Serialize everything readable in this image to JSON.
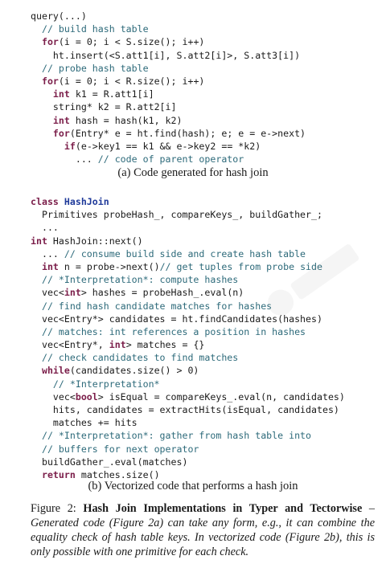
{
  "code_a": [
    {
      "indent": 0,
      "tokens": [
        {
          "t": "query(...)",
          "c": ""
        }
      ]
    },
    {
      "indent": 2,
      "tokens": [
        {
          "t": "// build hash table",
          "c": "cm"
        }
      ]
    },
    {
      "indent": 2,
      "tokens": [
        {
          "t": "for",
          "c": "kw"
        },
        {
          "t": "(i = 0; i < S.size(); i++)",
          "c": ""
        }
      ]
    },
    {
      "indent": 4,
      "tokens": [
        {
          "t": "ht.insert(<S.att1[i], S.att2[i]>, S.att3[i])",
          "c": ""
        }
      ]
    },
    {
      "indent": 2,
      "tokens": [
        {
          "t": "// probe hash table",
          "c": "cm"
        }
      ]
    },
    {
      "indent": 2,
      "tokens": [
        {
          "t": "for",
          "c": "kw"
        },
        {
          "t": "(i = 0; i < R.size(); i++)",
          "c": ""
        }
      ]
    },
    {
      "indent": 4,
      "tokens": [
        {
          "t": "int",
          "c": "kw"
        },
        {
          "t": " k1 = R.att1[i]",
          "c": ""
        }
      ]
    },
    {
      "indent": 4,
      "tokens": [
        {
          "t": "string",
          "c": ""
        },
        {
          "t": "* k2 = R.att2[i]",
          "c": ""
        }
      ]
    },
    {
      "indent": 4,
      "tokens": [
        {
          "t": "int",
          "c": "kw"
        },
        {
          "t": " hash = hash(k1, k2)",
          "c": ""
        }
      ]
    },
    {
      "indent": 4,
      "tokens": [
        {
          "t": "for",
          "c": "kw"
        },
        {
          "t": "(Entry* e = ht.find(hash); e; e = e->next)",
          "c": ""
        }
      ]
    },
    {
      "indent": 6,
      "tokens": [
        {
          "t": "if",
          "c": "kw"
        },
        {
          "t": "(e->key1 == k1 && e->key2 == *k2)",
          "c": ""
        }
      ]
    },
    {
      "indent": 8,
      "tokens": [
        {
          "t": "... ",
          "c": ""
        },
        {
          "t": "// code of parent operator",
          "c": "cm"
        }
      ]
    }
  ],
  "caption_a": "(a) Code generated for hash join",
  "code_b": [
    {
      "indent": 0,
      "tokens": [
        {
          "t": "class",
          "c": "kw"
        },
        {
          "t": " ",
          "c": ""
        },
        {
          "t": "HashJoin",
          "c": "cls"
        }
      ]
    },
    {
      "indent": 2,
      "tokens": [
        {
          "t": "Primitives probeHash_, compareKeys_, buildGather_;",
          "c": ""
        }
      ]
    },
    {
      "indent": 2,
      "tokens": [
        {
          "t": "...",
          "c": ""
        }
      ]
    },
    {
      "indent": 0,
      "tokens": [
        {
          "t": "int",
          "c": "kw"
        },
        {
          "t": " HashJoin::next()",
          "c": ""
        }
      ]
    },
    {
      "indent": 2,
      "tokens": [
        {
          "t": "... ",
          "c": ""
        },
        {
          "t": "// consume build side and create hash table",
          "c": "cm"
        }
      ]
    },
    {
      "indent": 2,
      "tokens": [
        {
          "t": "int",
          "c": "kw"
        },
        {
          "t": " n = probe->next()",
          "c": ""
        },
        {
          "t": "// get tuples from probe side",
          "c": "cm"
        }
      ]
    },
    {
      "indent": 2,
      "tokens": [
        {
          "t": "// *Interpretation*: compute hashes",
          "c": "cm"
        }
      ]
    },
    {
      "indent": 2,
      "tokens": [
        {
          "t": "vec<",
          "c": ""
        },
        {
          "t": "int",
          "c": "kw"
        },
        {
          "t": "> hashes = probeHash_.eval(n)",
          "c": ""
        }
      ]
    },
    {
      "indent": 2,
      "tokens": [
        {
          "t": "// find hash candidate matches for hashes",
          "c": "cm"
        }
      ]
    },
    {
      "indent": 2,
      "tokens": [
        {
          "t": "vec<Entry*> candidates = ht.findCandidates(hashes)",
          "c": ""
        }
      ]
    },
    {
      "indent": 2,
      "tokens": [
        {
          "t": "// matches: int references a position in hashes",
          "c": "cm"
        }
      ]
    },
    {
      "indent": 2,
      "tokens": [
        {
          "t": "vec<Entry*, ",
          "c": ""
        },
        {
          "t": "int",
          "c": "kw"
        },
        {
          "t": "> matches = {}",
          "c": ""
        }
      ]
    },
    {
      "indent": 2,
      "tokens": [
        {
          "t": "// check candidates to find matches",
          "c": "cm"
        }
      ]
    },
    {
      "indent": 2,
      "tokens": [
        {
          "t": "while",
          "c": "kw"
        },
        {
          "t": "(candidates.size() > 0)",
          "c": ""
        }
      ]
    },
    {
      "indent": 4,
      "tokens": [
        {
          "t": "// *Interpretation*",
          "c": "cm"
        }
      ]
    },
    {
      "indent": 4,
      "tokens": [
        {
          "t": "vec<",
          "c": ""
        },
        {
          "t": "bool",
          "c": "kw"
        },
        {
          "t": "> isEqual = compareKeys_.eval(n, candidates)",
          "c": ""
        }
      ]
    },
    {
      "indent": 4,
      "tokens": [
        {
          "t": "hits, candidates = extractHits(isEqual, candidates)",
          "c": ""
        }
      ]
    },
    {
      "indent": 4,
      "tokens": [
        {
          "t": "matches += hits",
          "c": ""
        }
      ]
    },
    {
      "indent": 2,
      "tokens": [
        {
          "t": "// *Interpretation*: gather from hash table into",
          "c": "cm"
        }
      ]
    },
    {
      "indent": 2,
      "tokens": [
        {
          "t": "// buffers for next operator",
          "c": "cm"
        }
      ]
    },
    {
      "indent": 2,
      "tokens": [
        {
          "t": "buildGather_.eval(matches)",
          "c": ""
        }
      ]
    },
    {
      "indent": 2,
      "tokens": [
        {
          "t": "return",
          "c": "kw"
        },
        {
          "t": " matches.size()",
          "c": ""
        }
      ]
    }
  ],
  "caption_b": "(b) Vectorized code that performs a hash join",
  "figure": {
    "label": "Figure 2: ",
    "title": "Hash Join Implementations in Typer and Tectorwise",
    "body": " – Generated code (Figure 2a) can take any form, e.g., it can combine the equality check of hash table keys. In vectorized code (Figure 2b), this is only possible with one primitive for each check."
  },
  "colors": {
    "keyword": "#7b1e4a",
    "comment": "#2d6a7a",
    "class": "#1f3a9a"
  }
}
